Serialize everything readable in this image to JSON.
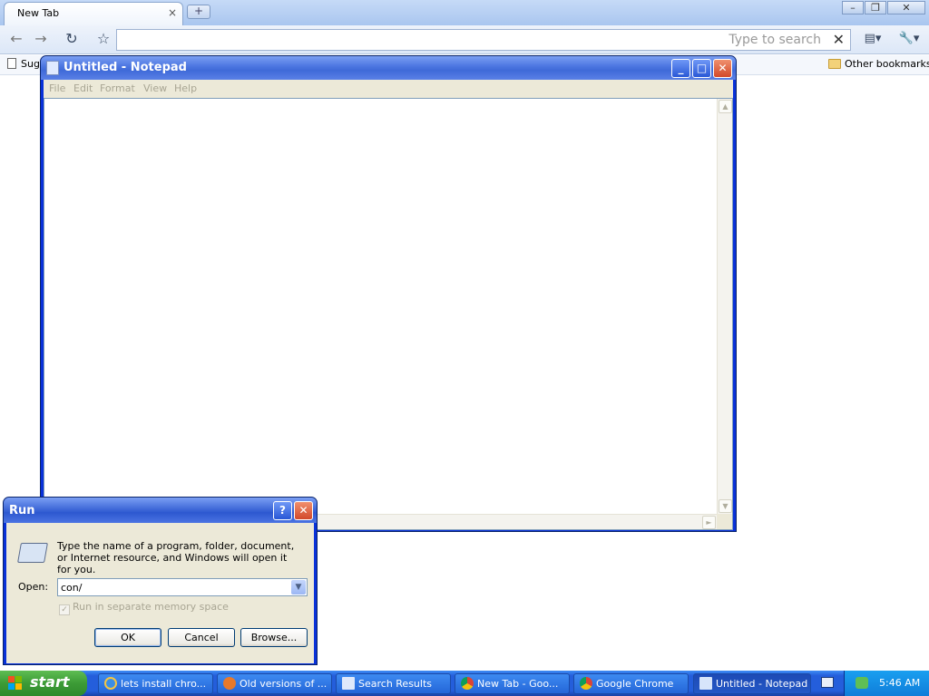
{
  "browser": {
    "tab_title": "New Tab",
    "tab_close": "×",
    "new_tab": "+",
    "window_controls": {
      "minimize": "–",
      "restore": "❐",
      "close": "✕"
    },
    "nav": {
      "back": "←",
      "forward": "→",
      "reload": "↻",
      "star": "☆"
    },
    "omnibox": {
      "value": "",
      "search_placeholder": "Type to search",
      "clear": "✕"
    },
    "page_menu": "▤▾",
    "wrench_menu": "🔧▾",
    "bookmarks": {
      "first_item": "Sug",
      "other_bookmarks": "Other bookmarks"
    }
  },
  "notepad": {
    "title": "Untitled - Notepad",
    "menu": [
      "File",
      "Edit",
      "Format",
      "View",
      "Help"
    ],
    "content": "",
    "controls": {
      "minimize": "_",
      "maximize": "□",
      "close": "✕"
    }
  },
  "run_dialog": {
    "title": "Run",
    "help": "?",
    "close": "✕",
    "description": "Type the name of a program, folder, document, or Internet resource, and Windows will open it for you.",
    "open_label": "Open:",
    "open_value": "con/",
    "checkbox_label": "Run in separate memory space",
    "checkbox_checked": true,
    "buttons": {
      "ok": "OK",
      "cancel": "Cancel",
      "browse": "Browse..."
    }
  },
  "taskbar": {
    "start_label": "start",
    "items": [
      {
        "label": "lets install chro...",
        "icon": "ie-icon",
        "active": false
      },
      {
        "label": "Old versions of ...",
        "icon": "firefox-icon",
        "active": false
      },
      {
        "label": "Search Results",
        "icon": "search-results-icon",
        "active": false
      },
      {
        "label": "New Tab - Goo...",
        "icon": "chrome-icon",
        "active": false
      },
      {
        "label": "Google Chrome",
        "icon": "chrome-icon",
        "active": false
      },
      {
        "label": "Untitled - Notepad",
        "icon": "notepad-icon",
        "active": true
      }
    ],
    "clock": "5:46 AM"
  },
  "colors": {
    "xp_title_blue": "#0831d9",
    "taskbar_blue": "#245edb",
    "start_green": "#3c9b36",
    "dialog_face": "#ece9d8"
  }
}
